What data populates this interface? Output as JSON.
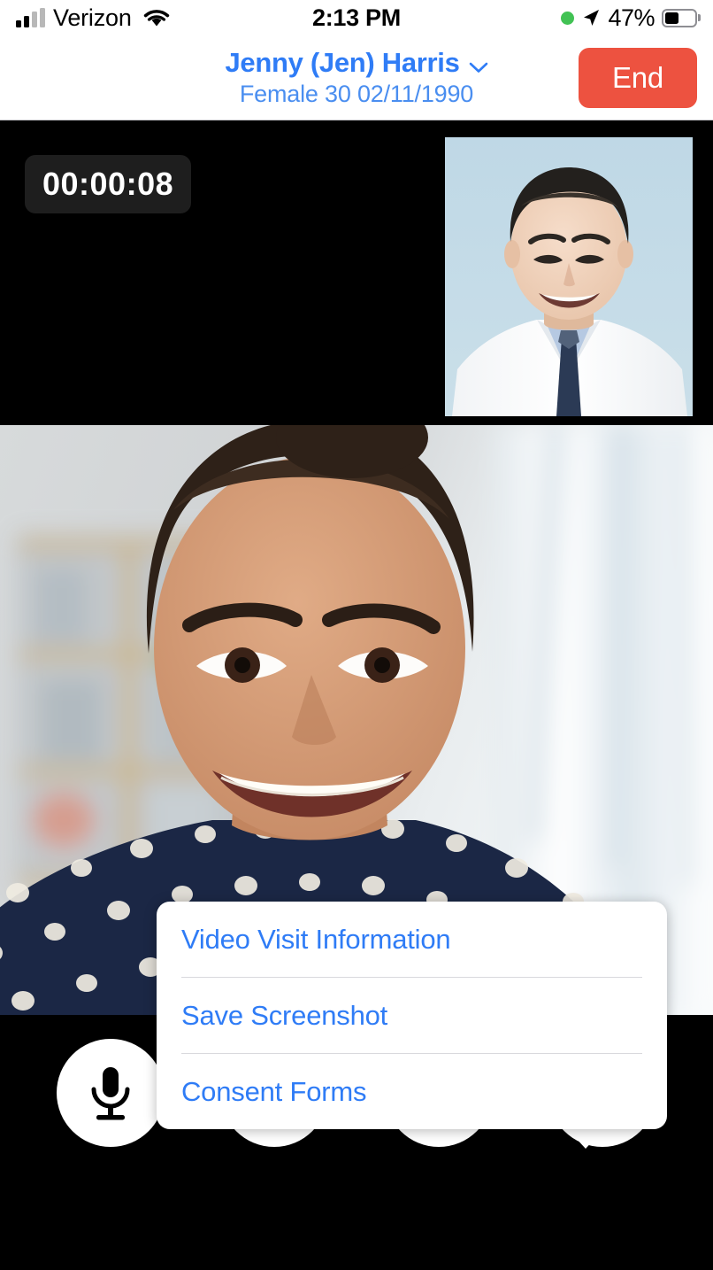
{
  "status_bar": {
    "carrier": "Verizon",
    "time": "2:13 PM",
    "battery_percent": "47%",
    "battery_level": 47,
    "signal_bars_filled": 2,
    "signal_bars_total": 4,
    "wifi_icon": "wifi-icon",
    "location_icon": "location-arrow-icon",
    "recording_dot_color": "#42c254",
    "battery_icon": "battery-icon"
  },
  "header": {
    "patient_name": "Jenny (Jen) Harris",
    "patient_details": "Female 30 02/11/1990",
    "chevron_icon": "chevron-down-icon",
    "end_label": "End",
    "end_color": "#ed5240",
    "title_color": "#2f7cf6"
  },
  "call": {
    "elapsed_time": "00:00:08",
    "self_view_label": "provider-self-view",
    "remote_view_label": "patient-video"
  },
  "popup_menu": {
    "items": [
      {
        "label": "Video Visit Information",
        "name": "video-visit-information"
      },
      {
        "label": "Save Screenshot",
        "name": "save-screenshot"
      },
      {
        "label": "Consent Forms",
        "name": "consent-forms"
      }
    ],
    "text_color": "#2f7cf6"
  },
  "controls": [
    {
      "name": "microphone-button",
      "icon": "microphone-icon"
    },
    {
      "name": "camera-button",
      "icon": "video-camera-icon"
    },
    {
      "name": "flip-camera-button",
      "icon": "camera-flip-icon"
    },
    {
      "name": "menu-button",
      "icon": "hamburger-menu-icon"
    }
  ]
}
